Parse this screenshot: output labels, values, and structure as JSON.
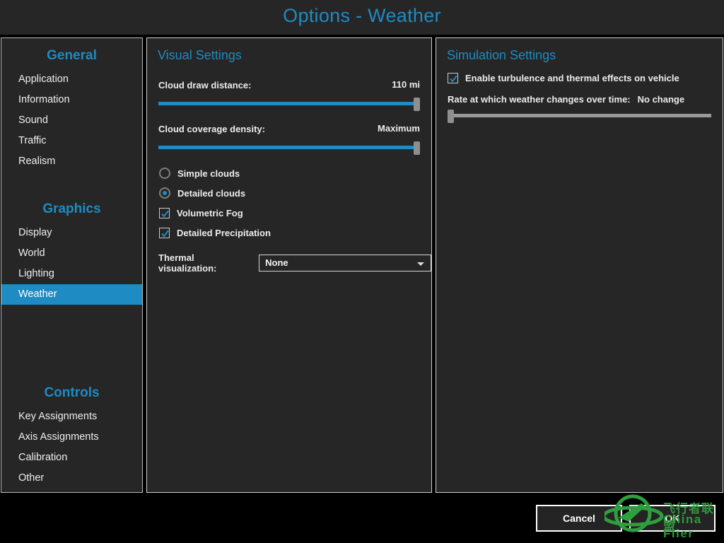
{
  "window": {
    "title": "Options - Weather"
  },
  "sidebar": {
    "groups": [
      {
        "title": "General",
        "items": [
          {
            "label": "Application",
            "active": false
          },
          {
            "label": "Information",
            "active": false
          },
          {
            "label": "Sound",
            "active": false
          },
          {
            "label": "Traffic",
            "active": false
          },
          {
            "label": "Realism",
            "active": false
          }
        ]
      },
      {
        "title": "Graphics",
        "items": [
          {
            "label": "Display",
            "active": false
          },
          {
            "label": "World",
            "active": false
          },
          {
            "label": "Lighting",
            "active": false
          },
          {
            "label": "Weather",
            "active": true
          }
        ]
      },
      {
        "title": "Controls",
        "items": [
          {
            "label": "Key Assignments",
            "active": false
          },
          {
            "label": "Axis Assignments",
            "active": false
          },
          {
            "label": "Calibration",
            "active": false
          },
          {
            "label": "Other",
            "active": false
          }
        ]
      }
    ]
  },
  "visual_settings": {
    "title": "Visual Settings",
    "cloud_draw_distance": {
      "label": "Cloud draw distance:",
      "value": "110 mi",
      "percent": 100
    },
    "cloud_coverage_density": {
      "label": "Cloud coverage density:",
      "value": "Maximum",
      "percent": 100
    },
    "cloud_detail": {
      "options": [
        {
          "label": "Simple clouds",
          "selected": false
        },
        {
          "label": "Detailed clouds",
          "selected": true
        }
      ]
    },
    "checkboxes": [
      {
        "label": "Volumetric Fog",
        "checked": true
      },
      {
        "label": "Detailed Precipitation",
        "checked": true
      }
    ],
    "thermal_visualization": {
      "label": "Thermal visualization:",
      "value": "None",
      "options": [
        "None"
      ]
    }
  },
  "simulation_settings": {
    "title": "Simulation Settings",
    "turbulence": {
      "label": "Enable turbulence and thermal effects on vehicle",
      "checked": true
    },
    "weather_rate": {
      "label": "Rate at which weather changes over time:",
      "value": "No change",
      "percent": 0
    }
  },
  "footer": {
    "cancel_label": "Cancel",
    "ok_label": "OK"
  },
  "watermark": {
    "chinese": "飞行者联盟",
    "english": "China Flier"
  },
  "colors": {
    "accent": "#1e8bc3",
    "panel_bg": "#262626",
    "page_bg": "#000000",
    "text": "#ececec",
    "watermark_green": "#2f9e3f"
  }
}
